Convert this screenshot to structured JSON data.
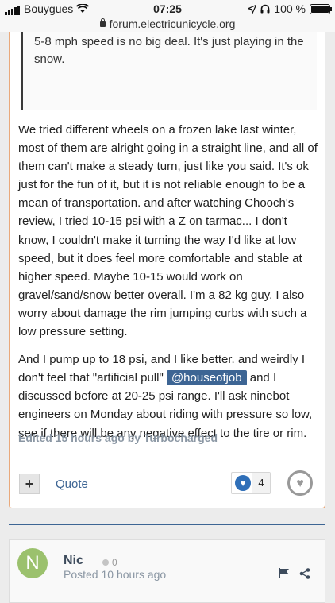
{
  "status_bar": {
    "carrier": "Bouygues",
    "time": "07:25",
    "battery": "100 %"
  },
  "url_bar": {
    "host": "forum.electricunicycle.org"
  },
  "post": {
    "quote_text": "5-8 mph speed is no big deal. It's just playing in the snow.",
    "paragraph1": "We tried different wheels on a frozen lake last winter, most of them are alright going in a straight line, and all of them can't make a steady turn, just like you said. It's ok just for the fun of it, but it is not reliable enough to be a mean of transportation. and after watching Chooch's review, I tried 10-15 psi with a Z on tarmac... I don't know, I couldn't make it turning the way I'd like at low speed, but it does feel more comfortable and stable at higher speed. Maybe 10-15 would work on gravel/sand/snow better overall. I'm a 82 kg guy, I also worry about damage the rim jumping curbs with such a low pressure setting.",
    "paragraph2_before": "And I pump up to 18 psi, and I like better. and weirdly I don't feel that \"artificial pull\" ",
    "mention": "@houseofjob",
    "paragraph2_after": " and I discussed before at 20-25 psi range. I'll ask ninebot engineers on Monday about riding with pressure so low, see if there will be any negative effect to the tire or rim.",
    "edited": "Edited 15 hours ago by Turbocharged",
    "actions": {
      "plus_label": "+",
      "quote_label": "Quote",
      "reaction_count": "4"
    }
  },
  "next_post": {
    "avatar_letter": "N",
    "author": "Nic",
    "reputation": "0",
    "posted": "Posted 10 hours ago"
  },
  "colors": {
    "accent": "#3d6594",
    "card_border": "#e9a97b",
    "avatar": "#9bc16d"
  }
}
